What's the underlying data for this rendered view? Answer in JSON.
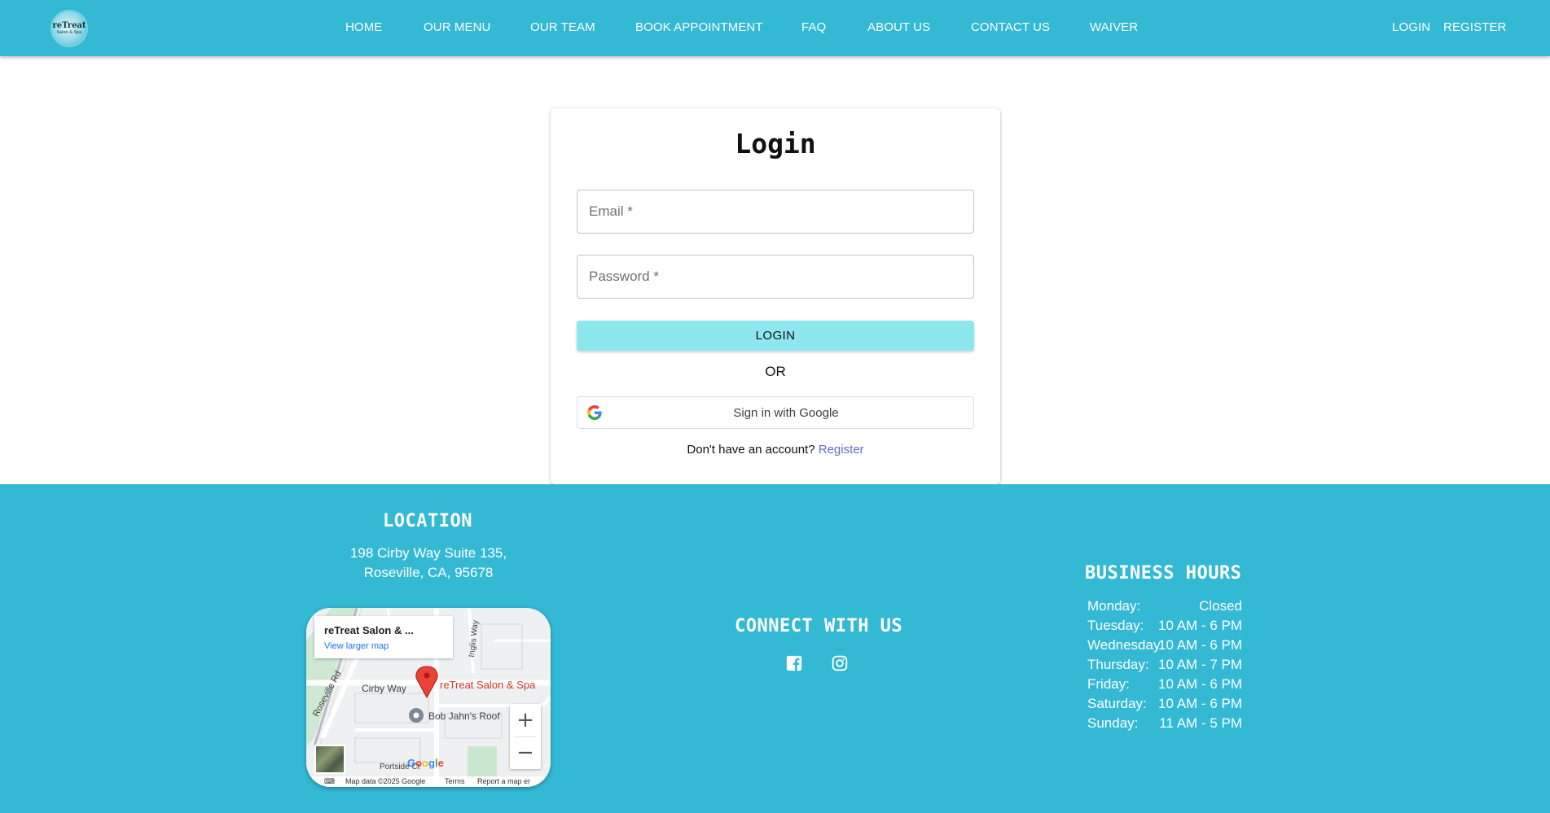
{
  "nav": {
    "logo": {
      "line1": "reTreat",
      "line2": "Salon & Spa"
    },
    "links": [
      "HOME",
      "OUR MENU",
      "OUR TEAM",
      "BOOK APPOINTMENT",
      "FAQ",
      "ABOUT US",
      "CONTACT US",
      "WAIVER"
    ],
    "auth": {
      "login": "LOGIN",
      "register": "REGISTER"
    }
  },
  "login": {
    "title": "Login",
    "email_placeholder": "Email *",
    "password_placeholder": "Password *",
    "login_button": "LOGIN",
    "or_text": "OR",
    "google_button": "Sign in with Google",
    "no_account_text": "Don't have an account?",
    "register_link": "Register"
  },
  "footer": {
    "location": {
      "heading": "LOCATION",
      "address_line1": "198 Cirby Way Suite 135,",
      "address_line2": "Roseville, CA, 95678"
    },
    "map": {
      "place_name": "reTreat Salon & ...",
      "view_larger": "View larger map",
      "pin_label": "reTreat Salon & Spa",
      "nearby_label": "Bob Jahn's Roof",
      "streets": [
        "Cirby Way",
        "Roseville Rd",
        "Inglis Way",
        "Portside Ct"
      ],
      "zoom_in": "+",
      "zoom_out": "−",
      "google_logo": "Google",
      "attribution": [
        "Map data ©2025 Google",
        "Terms",
        "Report a map er"
      ]
    },
    "connect": {
      "heading": "CONNECT WITH US",
      "icons": [
        "facebook-icon",
        "instagram-icon"
      ]
    },
    "hours": {
      "heading": "BUSINESS HOURS",
      "rows": [
        {
          "day": "Monday:",
          "time": "Closed"
        },
        {
          "day": "Tuesday:",
          "time": "10 AM - 6 PM"
        },
        {
          "day": "Wednesday:",
          "time": "10 AM - 6 PM"
        },
        {
          "day": "Thursday:",
          "time": "10 AM - 7 PM"
        },
        {
          "day": "Friday:",
          "time": "10 AM - 6 PM"
        },
        {
          "day": "Saturday:",
          "time": "10 AM - 6 PM"
        },
        {
          "day": "Sunday:",
          "time": "11 AM - 5 PM"
        }
      ]
    }
  },
  "colors": {
    "brand": "#33b9d4",
    "login_button": "#8ce7ef",
    "link": "#5b6cd6",
    "map_pin": "#ea4335"
  }
}
